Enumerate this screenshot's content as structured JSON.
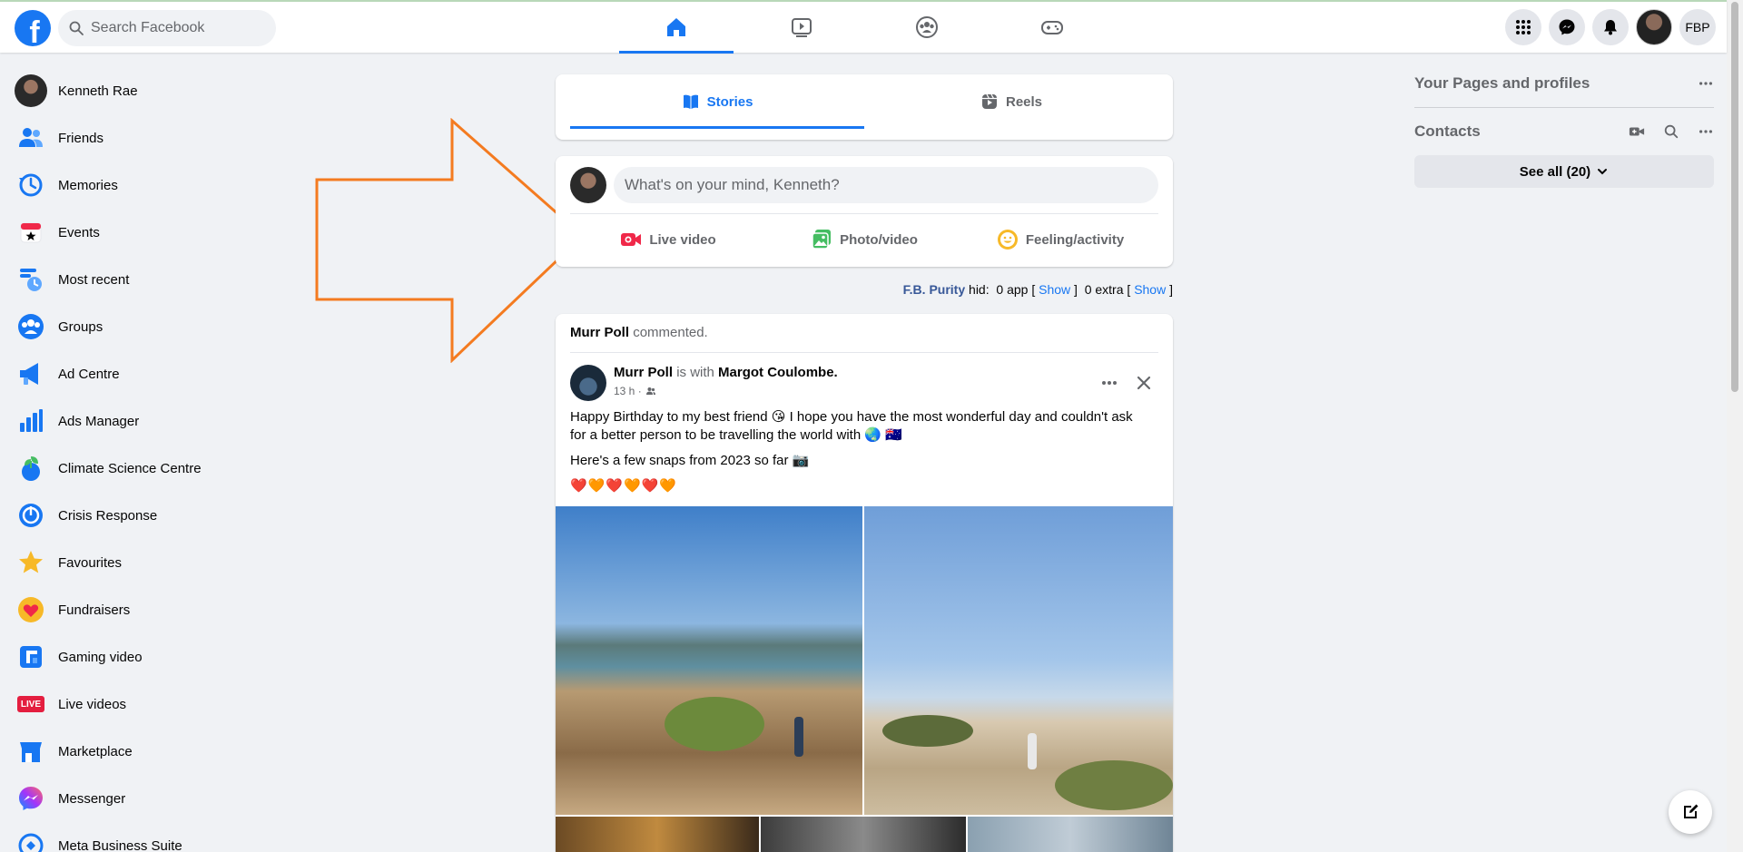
{
  "topbar": {
    "logo_letter": "f",
    "search_placeholder": "Search Facebook",
    "nav_tabs": [
      "home-icon",
      "watch-icon",
      "groups-icon",
      "gaming-icon"
    ],
    "profile_initials": "FBP"
  },
  "left_nav": {
    "items": [
      {
        "label": "Kenneth Rae",
        "icon": "user-avatar"
      },
      {
        "label": "Friends",
        "icon": "friends-icon"
      },
      {
        "label": "Memories",
        "icon": "memories-icon"
      },
      {
        "label": "Events",
        "icon": "events-icon"
      },
      {
        "label": "Most recent",
        "icon": "most-recent-icon"
      },
      {
        "label": "Groups",
        "icon": "groups-icon"
      },
      {
        "label": "Ad Centre",
        "icon": "ad-centre-icon"
      },
      {
        "label": "Ads Manager",
        "icon": "ads-manager-icon"
      },
      {
        "label": "Climate Science Centre",
        "icon": "climate-icon"
      },
      {
        "label": "Crisis Response",
        "icon": "crisis-response-icon"
      },
      {
        "label": "Favourites",
        "icon": "star-icon"
      },
      {
        "label": "Fundraisers",
        "icon": "heart-icon"
      },
      {
        "label": "Gaming video",
        "icon": "gaming-video-icon"
      },
      {
        "label": "Live videos",
        "icon": "live-icon"
      },
      {
        "label": "Marketplace",
        "icon": "marketplace-icon"
      },
      {
        "label": "Messenger",
        "icon": "messenger-icon"
      },
      {
        "label": "Meta Business Suite",
        "icon": "business-suite-icon"
      }
    ],
    "live_badge": "LIVE"
  },
  "stories": {
    "tabs": [
      {
        "label": "Stories",
        "active": true
      },
      {
        "label": "Reels",
        "active": false
      }
    ]
  },
  "composer": {
    "placeholder": "What's on your mind, Kenneth?",
    "actions": [
      {
        "label": "Live video",
        "color": "#f02849"
      },
      {
        "label": "Photo/video",
        "color": "#45bd62"
      },
      {
        "label": "Feeling/activity",
        "color": "#f7b928"
      }
    ]
  },
  "fbp_notice": {
    "brand": "F.B. Purity",
    "hid": "hid:",
    "app_text": "0 app [",
    "show1": "Show",
    "close1": "]",
    "extra_text": "0 extra [",
    "show2": "Show",
    "close2": "]"
  },
  "post": {
    "commenter": "Murr Poll",
    "commented": "commented.",
    "author": "Murr Poll",
    "is_with": "is with",
    "with_name": "Margot Coulombe.",
    "time": "13 h ·",
    "text1": "Happy Birthday to my best friend 😘 I hope you have the most wonderful day and couldn't ask for a better person to be travelling the world with 🌏 🇦🇺",
    "text2": "Here's a few snaps from 2023 so far 📷",
    "hearts": "❤️🧡❤️🧡❤️🧡"
  },
  "right_col": {
    "pages_title": "Your Pages and profiles",
    "contacts_title": "Contacts",
    "see_all": "See all (20)"
  },
  "colors": {
    "brand": "#1877f2",
    "annotation_arrow": "#f47b20"
  }
}
